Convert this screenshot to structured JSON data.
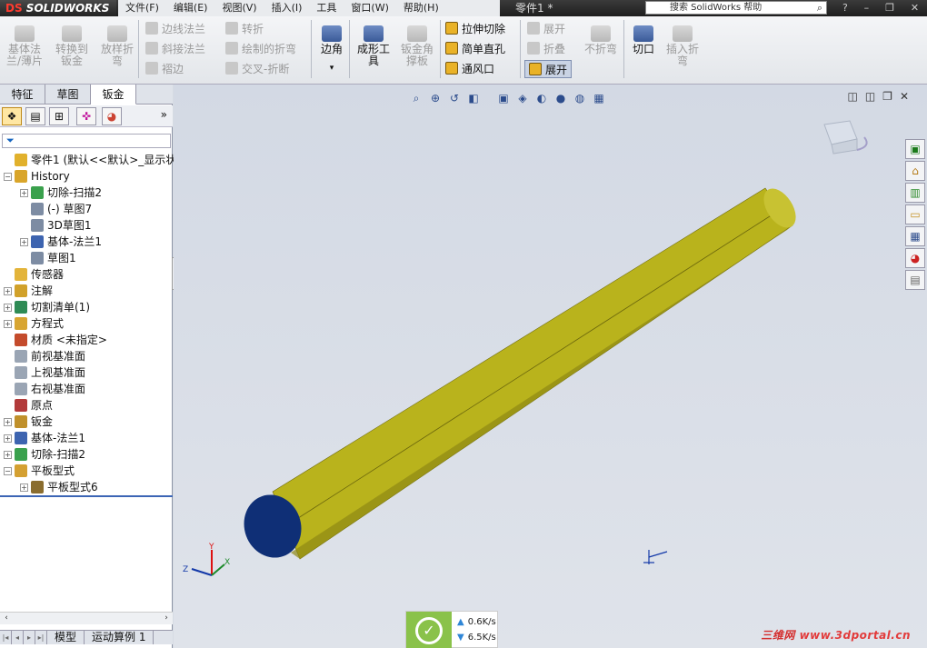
{
  "app": {
    "brand": "SOLIDWORKS",
    "brand_prefix": "DS",
    "document_title": "零件1 *",
    "help_search_placeholder": "搜索 SolidWorks 帮助"
  },
  "menu": [
    "文件(F)",
    "编辑(E)",
    "视图(V)",
    "插入(I)",
    "工具",
    "窗口(W)",
    "帮助(H)"
  ],
  "ribbon": {
    "big_buttons": [
      {
        "label": "基体法兰/薄片",
        "enabled": false
      },
      {
        "label": "转换到钣金",
        "enabled": false
      },
      {
        "label": "放样折弯",
        "enabled": false
      },
      {
        "label": "边角",
        "enabled": true
      },
      {
        "label": "成形工具",
        "enabled": true
      },
      {
        "label": "钣金角撑板",
        "enabled": false
      },
      {
        "label": "不折弯",
        "enabled": false
      },
      {
        "label": "切口",
        "enabled": true
      },
      {
        "label": "插入折弯",
        "enabled": false
      }
    ],
    "small_buttons": [
      {
        "label": "边线法兰",
        "enabled": false
      },
      {
        "label": "斜接法兰",
        "enabled": false
      },
      {
        "label": "褶边",
        "enabled": false
      },
      {
        "label": "转折",
        "enabled": false
      },
      {
        "label": "绘制的折弯",
        "enabled": false
      },
      {
        "label": "交叉-折断",
        "enabled": false
      },
      {
        "label": "拉伸切除",
        "enabled": true
      },
      {
        "label": "简单直孔",
        "enabled": true
      },
      {
        "label": "通风口",
        "enabled": true
      },
      {
        "label": "展开",
        "enabled": false
      },
      {
        "label": "折叠",
        "enabled": false
      },
      {
        "label": "展开",
        "enabled": true,
        "active": true
      }
    ]
  },
  "panel": {
    "tabs": [
      "特征",
      "草图",
      "钣金"
    ],
    "selected_tab": "钣金",
    "tree": [
      {
        "label": "零件1  (默认<<默认>_显示状态",
        "level": 0,
        "expander": "none",
        "icon_color": "#e1b12c"
      },
      {
        "label": "History",
        "level": 0,
        "expander": "minus",
        "icon_color": "#d9a52a"
      },
      {
        "label": "切除-扫描2",
        "level": 1,
        "expander": "plus",
        "icon_color": "#3aa14d"
      },
      {
        "label": "(-) 草图7",
        "level": 1,
        "expander": "none",
        "icon_color": "#7d8ca3"
      },
      {
        "label": "3D草图1",
        "level": 1,
        "expander": "none",
        "icon_color": "#7d8ca3"
      },
      {
        "label": "基体-法兰1",
        "level": 1,
        "expander": "plus",
        "icon_color": "#3d64b0"
      },
      {
        "label": "草图1",
        "level": 1,
        "expander": "none",
        "icon_color": "#7d8ca3"
      },
      {
        "label": "传感器",
        "level": 0,
        "expander": "none",
        "icon_color": "#e3b43a"
      },
      {
        "label": "注解",
        "level": 0,
        "expander": "plus",
        "icon_color": "#d1a12a"
      },
      {
        "label": "切割清单(1)",
        "level": 0,
        "expander": "plus",
        "icon_color": "#2f8b55"
      },
      {
        "label": "方程式",
        "level": 0,
        "expander": "plus",
        "icon_color": "#d8a531"
      },
      {
        "label": "材质 <未指定>",
        "level": 0,
        "expander": "none",
        "icon_color": "#c44b2c"
      },
      {
        "label": "前视基准面",
        "level": 0,
        "expander": "none",
        "icon_color": "#9aa5b4"
      },
      {
        "label": "上视基准面",
        "level": 0,
        "expander": "none",
        "icon_color": "#9aa5b4"
      },
      {
        "label": "右视基准面",
        "level": 0,
        "expander": "none",
        "icon_color": "#9aa5b4"
      },
      {
        "label": "原点",
        "level": 0,
        "expander": "none",
        "icon_color": "#b23a3a"
      },
      {
        "label": "钣金",
        "level": 0,
        "expander": "plus",
        "icon_color": "#c0902b"
      },
      {
        "label": "基体-法兰1",
        "level": 0,
        "expander": "plus",
        "icon_color": "#3d64b0"
      },
      {
        "label": "切除-扫描2",
        "level": 0,
        "expander": "plus",
        "icon_color": "#3aa14d"
      },
      {
        "label": "平板型式",
        "level": 0,
        "expander": "minus",
        "icon_color": "#d4a032"
      },
      {
        "label": "平板型式6",
        "level": 1,
        "expander": "plus",
        "icon_color": "#8a6d2f"
      }
    ],
    "bottom_tabs": [
      "模型",
      "运动算例 1"
    ]
  },
  "network": {
    "upload": "0.6K/s",
    "download": "6.5K/s"
  },
  "watermark": {
    "cn": "三维网",
    "url": "www.3dportal.cn"
  },
  "colors": {
    "cylinder_body": "#b8b21b",
    "cylinder_end": "#0f2f76",
    "accent": "#3c65b5"
  }
}
